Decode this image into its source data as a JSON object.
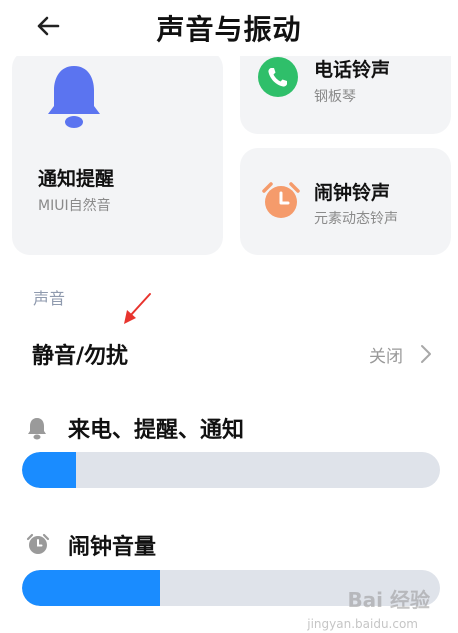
{
  "header": {
    "title": "声音与振动"
  },
  "cards": {
    "notification": {
      "title": "通知提醒",
      "subtitle": "MIUI自然音"
    },
    "phone": {
      "title": "电话铃声",
      "subtitle": "钢板琴"
    },
    "alarm": {
      "title": "闹钟铃声",
      "subtitle": "元素动态铃声"
    }
  },
  "section": {
    "label": "声音"
  },
  "mute": {
    "title": "静音/勿扰",
    "value": "关闭"
  },
  "volumes": {
    "ring": {
      "label": "来电、提醒、通知",
      "level": 0.13
    },
    "alarm": {
      "label": "闹钟音量",
      "level": 0.33
    }
  },
  "colors": {
    "accent": "#1a8cff",
    "bell": "#5b74f0",
    "phone": "#2fbf6a",
    "alarm": "#f59b6b"
  },
  "watermark": {
    "text": "Bai 经验",
    "sub": "jingyan.baidu.com"
  }
}
